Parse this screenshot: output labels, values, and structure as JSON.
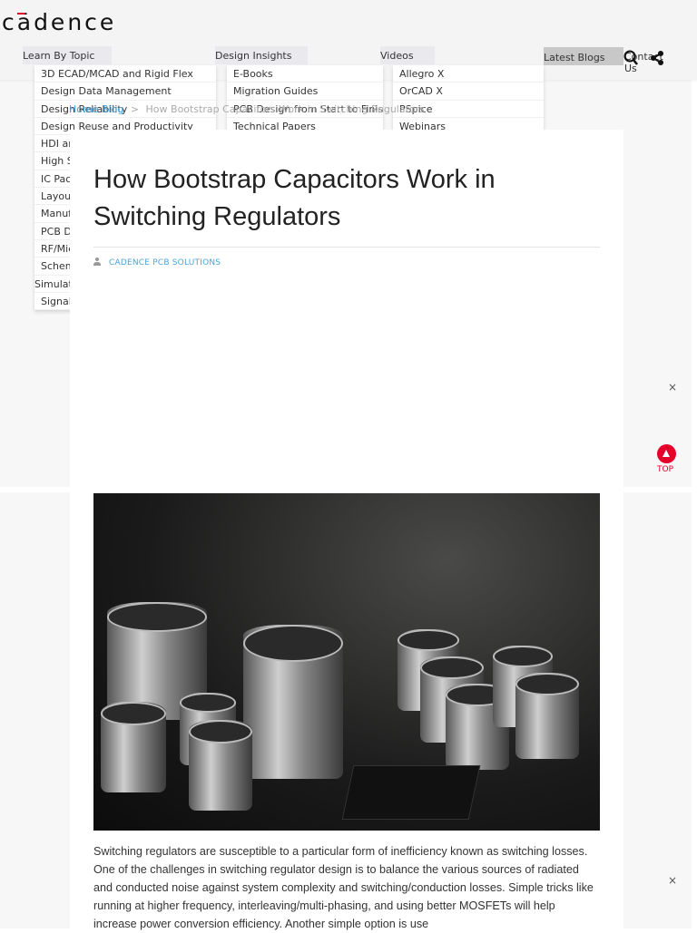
{
  "logo": "cādence",
  "nav": {
    "learn": "Learn By Topic",
    "insights": "Design Insights",
    "videos": "Videos",
    "latest": "Latest Blogs",
    "contact": "Contact Us"
  },
  "menus": {
    "learn": [
      "3D ECAD/MCAD and Rigid Flex",
      "Design Data Management",
      "Design Reliability",
      "Design Reuse and Productivity",
      "HDI and Advanced Fabrication",
      "High Speed Design",
      "IC Packaging",
      "Layout and Routing",
      "Manufacturing",
      "PCB Design",
      "RF/Microwave Design",
      "Schematic Capture",
      "Simulation and Analysis",
      "Signal/Power Integrity"
    ],
    "insights": [
      "E-Books",
      "Migration Guides",
      "PCB Design from Start to Finish",
      "Technical Papers"
    ],
    "videos": [
      "Allegro X",
      "OrCAD X",
      "PSpice",
      "Webinars"
    ]
  },
  "breadcrumb": {
    "home": "Home",
    "blog": "Blog",
    "sep": ">",
    "current": "How Bootstrap Capacitors Work in Switching Regulators"
  },
  "article": {
    "title": "How Bootstrap Capacitors Work in Switching Regulators",
    "author": "CADENCE PCB SOLUTIONS",
    "body": "Switching regulators are susceptible to a particular form of inefficiency known as switching losses. One of the challenges in switching regulator design is to balance the various sources of radiated and conducted noise against system complexity and switching/conduction losses. Simple tricks like running at higher frequency, interleaving/multi-phasing, and using better MOSFETs will help increase power conversion efficiency. Another simple option is use"
  },
  "close": "×",
  "top": "TOP",
  "colors": {
    "accent": "#e4002b",
    "link": "#4aa3d8"
  }
}
